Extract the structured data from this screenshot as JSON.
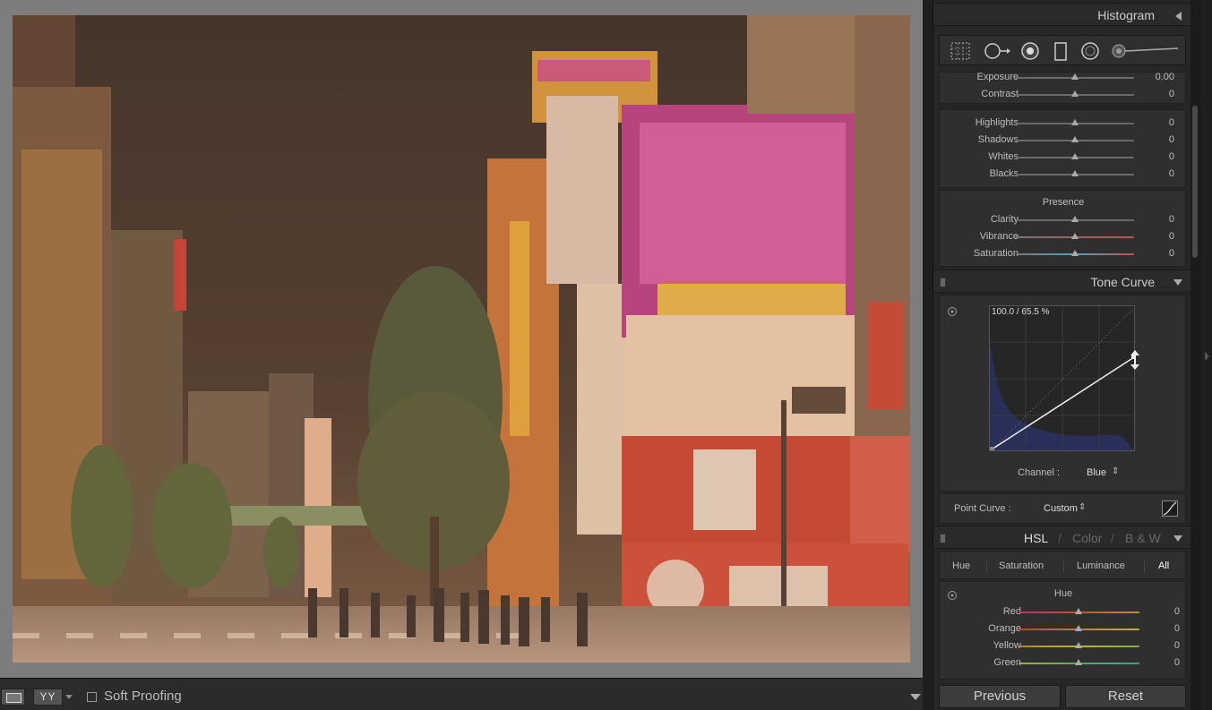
{
  "toolbar": {
    "yy_label": "YY",
    "soft_proofing_label": "Soft Proofing"
  },
  "histogram": {
    "title": "Histogram"
  },
  "basic": {
    "sliders": [
      {
        "label": "Exposure",
        "value": "0.00",
        "pos": 0.5
      },
      {
        "label": "Contrast",
        "value": "0",
        "pos": 0.5
      },
      {
        "label": "Highlights",
        "value": "0",
        "pos": 0.5
      },
      {
        "label": "Shadows",
        "value": "0",
        "pos": 0.5
      },
      {
        "label": "Whites",
        "value": "0",
        "pos": 0.5
      },
      {
        "label": "Blacks",
        "value": "0",
        "pos": 0.5
      }
    ],
    "presence_title": "Presence",
    "presence_sliders": [
      {
        "label": "Clarity",
        "value": "0",
        "pos": 0.5
      },
      {
        "label": "Vibrance",
        "value": "0",
        "pos": 0.5
      },
      {
        "label": "Saturation",
        "value": "0",
        "pos": 0.5
      }
    ]
  },
  "tone_curve": {
    "title": "Tone Curve",
    "readout": "100.0 / 65.5 %",
    "channel_label": "Channel :",
    "channel_value": "Blue",
    "point_curve_label": "Point Curve :",
    "point_curve_value": "Custom"
  },
  "hsl": {
    "title_hsl": "HSL",
    "title_color": "Color",
    "title_bw": "B & W",
    "sep": "/",
    "tabs": [
      "Hue",
      "Saturation",
      "Luminance",
      "All"
    ],
    "group_title": "Hue",
    "sliders": [
      {
        "label": "Red",
        "value": "0",
        "pos": 0.5
      },
      {
        "label": "Orange",
        "value": "0",
        "pos": 0.5
      },
      {
        "label": "Yellow",
        "value": "0",
        "pos": 0.5
      },
      {
        "label": "Green",
        "value": "0",
        "pos": 0.5
      }
    ]
  },
  "buttons": {
    "previous": "Previous",
    "reset": "Reset"
  },
  "colors": {
    "panel_bg": "#262626",
    "viewer_bg": "#7d7d7d",
    "curve_fill": "#2a2f5a"
  }
}
